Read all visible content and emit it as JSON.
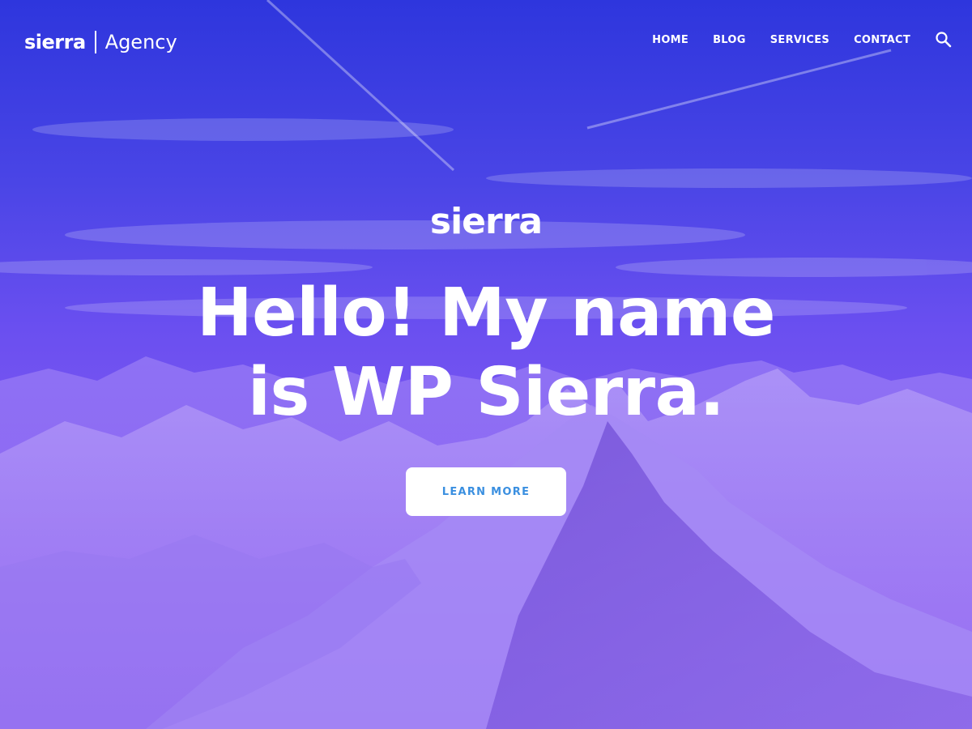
{
  "header": {
    "logo_mark": "sierra",
    "logo_suffix": "Agency",
    "nav": [
      {
        "label": "HOME"
      },
      {
        "label": "BLOG"
      },
      {
        "label": "SERVICES"
      },
      {
        "label": "CONTACT"
      }
    ],
    "search_icon": "search-icon"
  },
  "hero": {
    "brand": "sierra",
    "headline_line1": "Hello! My name",
    "headline_line2": "is WP Sierra.",
    "cta_label": "LEARN MORE"
  },
  "colors": {
    "gradient_top": "#2e36dd",
    "gradient_bottom": "#8a5cf0",
    "cta_text": "#3a8fe0",
    "text": "#ffffff"
  }
}
